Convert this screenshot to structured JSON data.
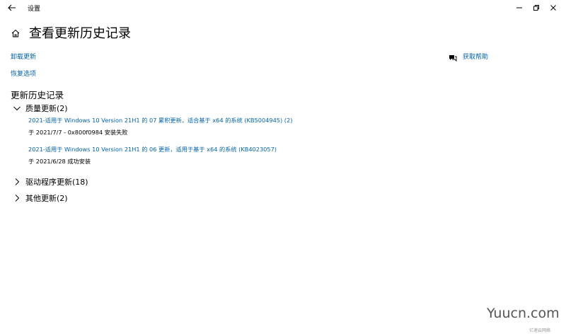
{
  "window": {
    "title": "设置",
    "back_icon": "back-arrow-icon",
    "minimize_icon": "minimize-icon",
    "restore_icon": "restore-icon",
    "close_icon": "close-icon"
  },
  "header": {
    "home_icon": "home-icon",
    "title": "查看更新历史记录"
  },
  "links": {
    "uninstall": "卸载更新",
    "recovery": "恢复选项",
    "help": "获取帮助",
    "help_icon": "chat-help-icon"
  },
  "history": {
    "section_title": "更新历史记录",
    "quality": {
      "label": "质量更新(2)",
      "expanded": true,
      "items": [
        {
          "title": "2021-适用于 Windows 10 Version 21H1 的 07 累积更新，适合基于 x64 的系统 (KB5004945) (2)",
          "status": "于 2021/7/7 - 0x800f0984 安装失败"
        },
        {
          "title": "2021-适用于 Windows 10 Version 21H1 的 06 更新，适用于基于 x64 的系统 (KB4023057)",
          "status": "于 2021/6/28 成功安装"
        }
      ]
    },
    "drivers": {
      "label": "驱动程序更新(18)",
      "expanded": false
    },
    "other": {
      "label": "其他更新(2)",
      "expanded": false
    }
  },
  "watermark": {
    "text": "Yuucn.com",
    "small": "亿速云网络"
  },
  "colors": {
    "link": "#0063b1",
    "text": "#000000",
    "background": "#ffffff"
  }
}
